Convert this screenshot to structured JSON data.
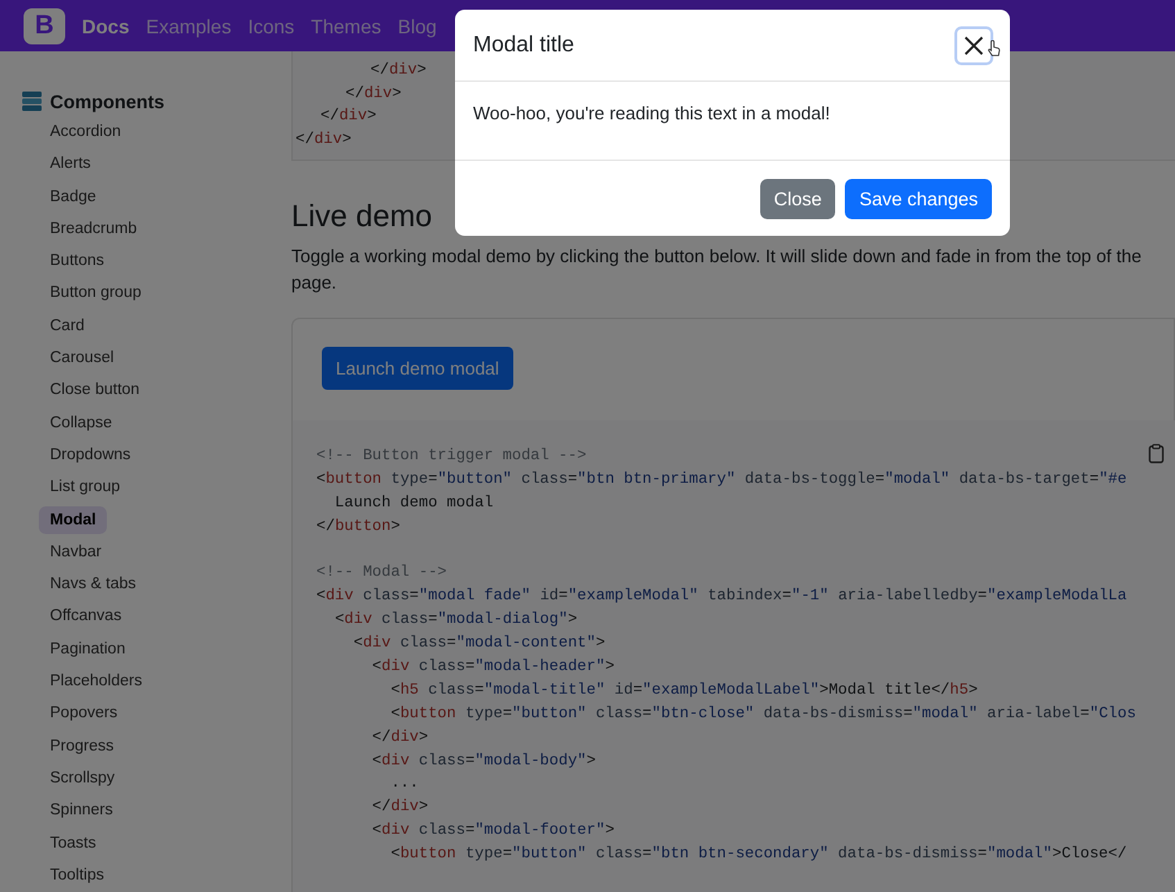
{
  "navbar": {
    "logo": "B",
    "links": [
      {
        "label": "Docs",
        "selected": true
      },
      {
        "label": "Examples",
        "selected": false
      },
      {
        "label": "Icons",
        "selected": false
      },
      {
        "label": "Themes",
        "selected": false
      },
      {
        "label": "Blog",
        "selected": false
      }
    ]
  },
  "sidebar": {
    "section": "Components",
    "items": [
      {
        "label": "Accordion",
        "selected": false
      },
      {
        "label": "Alerts",
        "selected": false
      },
      {
        "label": "Badge",
        "selected": false
      },
      {
        "label": "Breadcrumb",
        "selected": false
      },
      {
        "label": "Buttons",
        "selected": false
      },
      {
        "label": "Button group",
        "selected": false
      },
      {
        "label": "Card",
        "selected": false
      },
      {
        "label": "Carousel",
        "selected": false
      },
      {
        "label": "Close button",
        "selected": false
      },
      {
        "label": "Collapse",
        "selected": false
      },
      {
        "label": "Dropdowns",
        "selected": false
      },
      {
        "label": "List group",
        "selected": false
      },
      {
        "label": "Modal",
        "selected": true
      },
      {
        "label": "Navbar",
        "selected": false
      },
      {
        "label": "Navs & tabs",
        "selected": false
      },
      {
        "label": "Offcanvas",
        "selected": false
      },
      {
        "label": "Pagination",
        "selected": false
      },
      {
        "label": "Placeholders",
        "selected": false
      },
      {
        "label": "Popovers",
        "selected": false
      },
      {
        "label": "Progress",
        "selected": false
      },
      {
        "label": "Scrollspy",
        "selected": false
      },
      {
        "label": "Spinners",
        "selected": false
      },
      {
        "label": "Toasts",
        "selected": false
      },
      {
        "label": "Tooltips",
        "selected": false
      }
    ]
  },
  "top_code": {
    "lines": [
      "</div>",
      "</div>",
      "</div>",
      "</div>"
    ]
  },
  "section": {
    "heading": "Live demo",
    "text": "Toggle a working modal demo by clicking the button below. It will slide down and fade in from the top of the page.",
    "demo_button": "Launch demo modal"
  },
  "code": {
    "blocks": [
      {
        "lines": [
          "<!-- Button trigger modal -->",
          "<button type=\"button\" class=\"btn btn-primary\" data-bs-toggle=\"modal\" data-bs-target=\"#e",
          "  Launch demo modal",
          "</button>"
        ]
      },
      {
        "lines": [
          "<!-- Modal -->",
          "<div class=\"modal fade\" id=\"exampleModal\" tabindex=\"-1\" aria-labelledby=\"exampleModalLa",
          "  <div class=\"modal-dialog\">",
          "    <div class=\"modal-content\">",
          "      <div class=\"modal-header\">",
          "        <h5 class=\"modal-title\" id=\"exampleModalLabel\">Modal title</h5>",
          "        <button type=\"button\" class=\"btn-close\" data-bs-dismiss=\"modal\" aria-label=\"Clos",
          "      </div>",
          "      <div class=\"modal-body\">",
          "        ...",
          "      </div>",
          "      <div class=\"modal-footer\">",
          "        <button type=\"button\" class=\"btn btn-secondary\" data-bs-dismiss=\"modal\">Close</"
        ]
      }
    ]
  },
  "modal": {
    "title": "Modal title",
    "body": "Woo-hoo, you're reading this text in a modal!",
    "buttons": [
      {
        "label": "Close",
        "kind": "secondary"
      },
      {
        "label": "Save changes",
        "kind": "primary"
      }
    ]
  }
}
